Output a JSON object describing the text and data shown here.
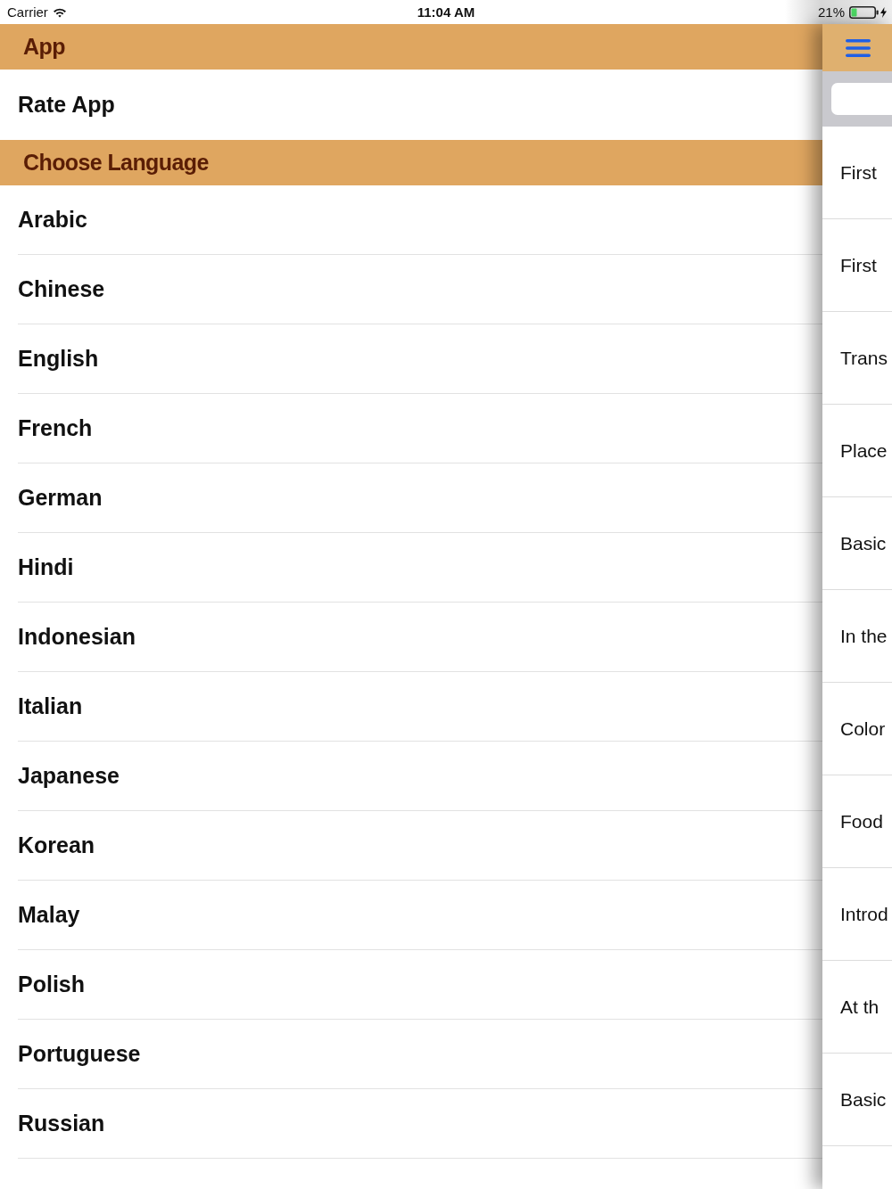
{
  "status_bar": {
    "carrier": "Carrier",
    "time": "11:04 AM",
    "battery": "21%"
  },
  "menu": {
    "sections": [
      {
        "title": "App",
        "items": [
          "Rate App"
        ]
      },
      {
        "title": "Choose Language",
        "items": [
          "Arabic",
          "Chinese",
          "English",
          "French",
          "German",
          "Hindi",
          "Indonesian",
          "Italian",
          "Japanese",
          "Korean",
          "Malay",
          "Polish",
          "Portuguese",
          "Russian"
        ]
      }
    ]
  },
  "side_panel": {
    "items": [
      "First",
      "First",
      "Trans",
      "Place",
      "Basic",
      "In the",
      "Color",
      "Food",
      "Introd",
      "At th",
      "Basic"
    ]
  }
}
